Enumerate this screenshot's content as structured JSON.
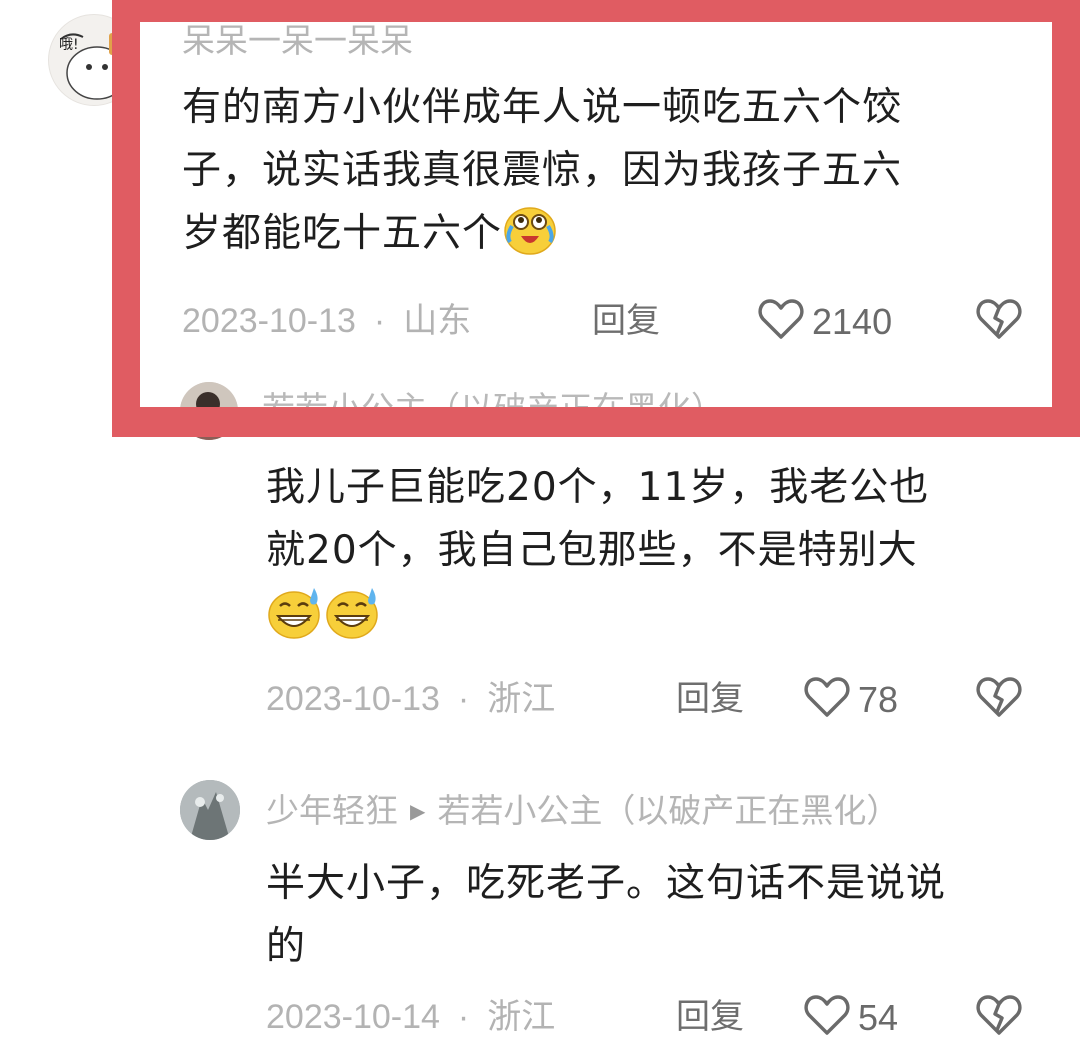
{
  "comments": [
    {
      "username": "呆呆一呆一呆呆",
      "text_lines": [
        "有的南方小伙伴成年人说一顿吃五六个饺",
        "子，说实话我真很震惊，因为我孩子五六",
        "岁都能吃十五六个"
      ],
      "emoji": "laugh-cry-emoji",
      "date": "2023-10-13",
      "location": "山东",
      "reply_label": "回复",
      "likes": "2140"
    },
    {
      "username": "若若小公主（以破产正在黑化）",
      "text_lines": [
        "我儿子巨能吃20个，11岁，我老公也",
        "就20个，我自己包那些，不是特别大"
      ],
      "emoji": "grin-sweat-emoji",
      "date": "2023-10-13",
      "location": "浙江",
      "reply_label": "回复",
      "likes": "78"
    },
    {
      "username": "少年轻狂",
      "reply_to": "若若小公主（以破产正在黑化）",
      "text_lines": [
        "半大小子，吃死老子。这句话不是说说",
        "的"
      ],
      "date": "2023-10-14",
      "location": "浙江",
      "reply_label": "回复",
      "likes": "54"
    }
  ],
  "separator": "·",
  "colors": {
    "highlight": "#e05c62",
    "meta_text": "#b3b3b3",
    "body_text": "#1e1e1e"
  }
}
